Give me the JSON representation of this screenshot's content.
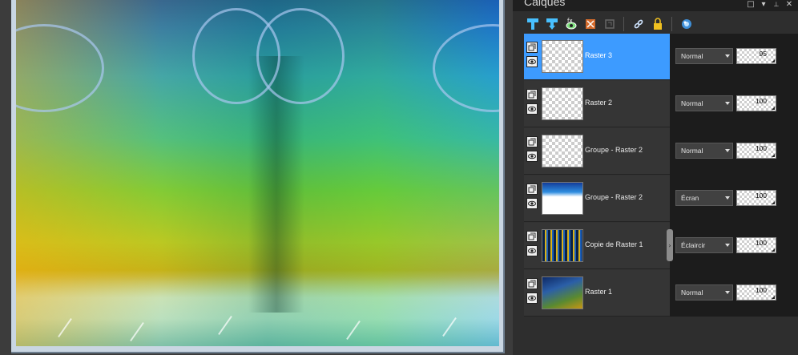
{
  "panel": {
    "title": "Calques",
    "buttons": {
      "restore": "□",
      "menu": "▾",
      "pin": "📌",
      "close": "✕"
    }
  },
  "toolbar": {
    "items": [
      {
        "name": "new-raster-layer-icon"
      },
      {
        "name": "new-vector-layer-icon"
      },
      {
        "name": "new-mask-layer-icon"
      },
      {
        "name": "delete-layer-icon"
      },
      {
        "name": "duplicate-layer-icon"
      },
      {
        "name": "link-layer-icon"
      },
      {
        "name": "lock-layer-icon"
      },
      {
        "name": "layer-properties-icon"
      }
    ]
  },
  "layers": [
    {
      "name": "Raster 3",
      "blend": "Normal",
      "opacity": "95",
      "selected": true,
      "thumb": "checker"
    },
    {
      "name": "Raster 2",
      "blend": "Normal",
      "opacity": "100",
      "selected": false,
      "thumb": "checker"
    },
    {
      "name": "Groupe - Raster 2",
      "blend": "Normal",
      "opacity": "100",
      "selected": false,
      "thumb": "checker"
    },
    {
      "name": "Groupe - Raster 2",
      "blend": "Écran",
      "opacity": "100",
      "selected": false,
      "thumb": "blue"
    },
    {
      "name": "Copie de Raster 1",
      "blend": "Éclaircir",
      "opacity": "100",
      "selected": false,
      "thumb": "streaks"
    },
    {
      "name": "Raster 1",
      "blend": "Normal",
      "opacity": "100",
      "selected": false,
      "thumb": "grad"
    }
  ],
  "colors": {
    "selection": "#3d9bff",
    "panel_bg": "#2e2e2e"
  }
}
